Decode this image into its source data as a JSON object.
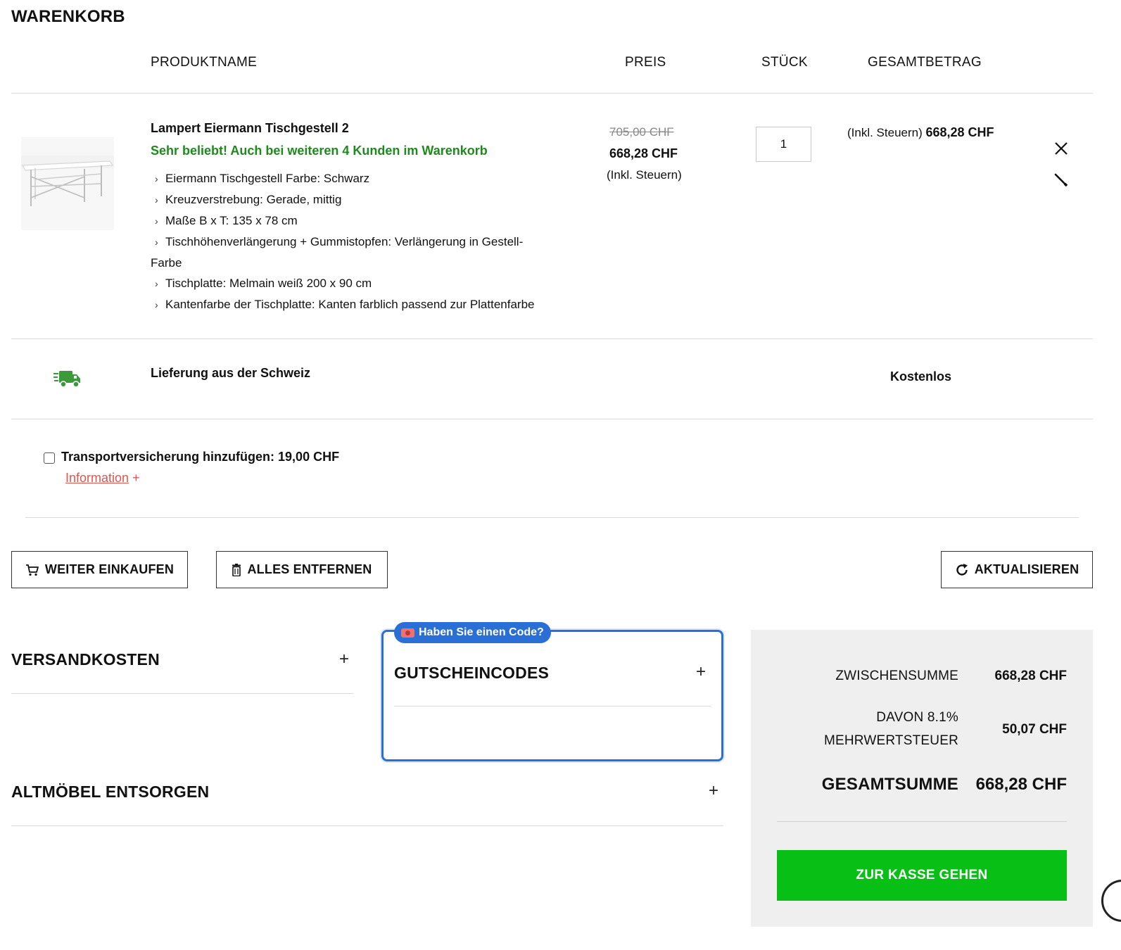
{
  "page_title": "WARENKORB",
  "columns": {
    "product": "PRODUKTNAME",
    "price": "PREIS",
    "qty": "STÜCK",
    "total": "GESAMTBETRAG"
  },
  "item": {
    "name": "Lampert Eiermann Tischgestell 2",
    "popular_note": "Sehr beliebt! Auch bei weiteren 4 Kunden im Warenkorb",
    "attributes": [
      "Eiermann Tischgestell Farbe: Schwarz",
      "Kreuzverstrebung: Gerade, mittig",
      "Maße B x T: 135 x 78 cm",
      "Tischhöhenverlängerung + Gummistopfen: Verlängerung in Gestell-Farbe",
      "Tischplatte: Melmain weiß 200 x 90 cm",
      "Kantenfarbe der Tischplatte: Kanten farblich passend zur Plattenfarbe"
    ],
    "old_price": "705,00 CHF",
    "price": "668,28 CHF",
    "tax_note": "(Inkl. Steuern)",
    "quantity": "1",
    "total_prefix": "(Inkl. Steuern)",
    "total": "668,28 CHF"
  },
  "delivery": {
    "label": "Lieferung aus der Schweiz",
    "cost": "Kostenlos",
    "icon": "truck-icon"
  },
  "insurance": {
    "label": "Transportversicherung hinzufügen: 19,00 CHF",
    "info_link": "Information",
    "info_plus": "+"
  },
  "buttons": {
    "continue": "WEITER EINKAUFEN",
    "clear": "ALLES ENTFERNEN",
    "update": "AKTUALISIEREN",
    "checkout": "ZUR KASSE GEHEN"
  },
  "sections": {
    "shipping": "VERSANDKOSTEN",
    "coupons": "GUTSCHEINCODES",
    "coupon_badge": "Haben Sie einen Code?",
    "disposal": "ALTMÖBEL ENTSORGEN",
    "plus": "+"
  },
  "summary": {
    "subtotal_label": "ZWISCHENSUMME",
    "subtotal": "668,28 CHF",
    "vat_label_1": "DAVON 8.1%",
    "vat_label_2": "MEHRWERTSTEUER",
    "vat": "50,07 CHF",
    "grand_total_label": "GESAMTSUMME",
    "grand_total": "668,28 CHF"
  },
  "colors": {
    "accent_green": "#08bf16",
    "popular_green": "#1e8a1e",
    "coupon_blue": "#2a6fd6",
    "link_red": "#e0564f",
    "summary_bg": "#efefef"
  }
}
